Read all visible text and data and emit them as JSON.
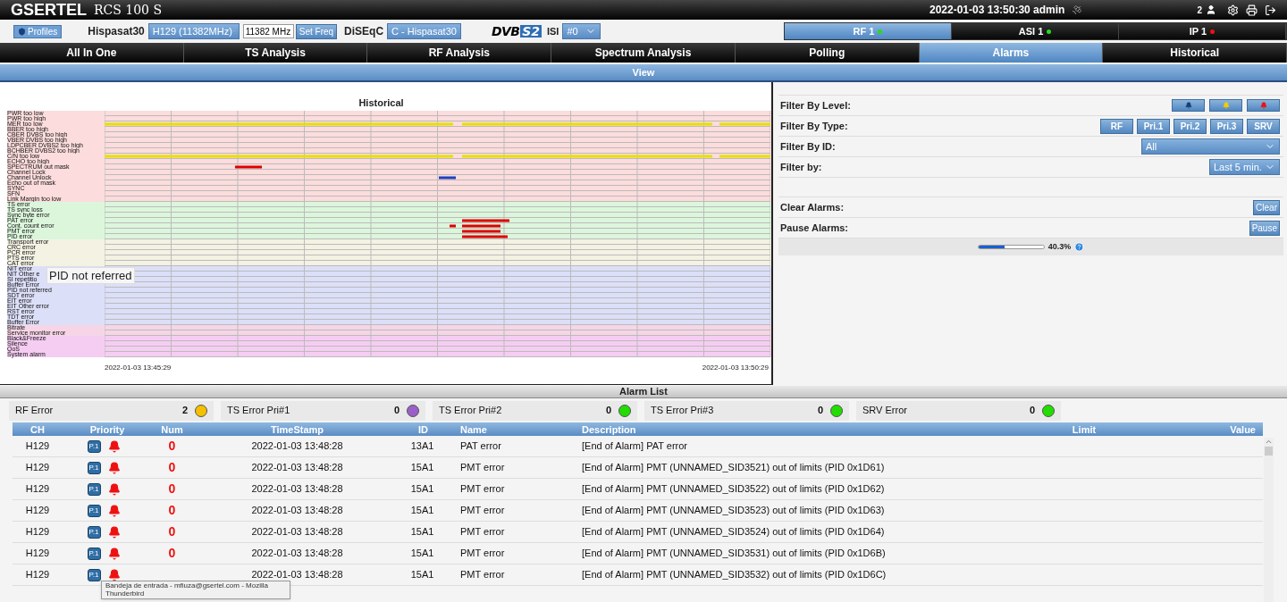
{
  "header": {
    "brand": "GSERTEL",
    "product": "RCS 100 S",
    "datetime_user": "2022-01-03 13:50:30 admin",
    "user_count": "2"
  },
  "toolbar": {
    "profiles_button": "Profiles",
    "satellite_label": "Hispasat30",
    "channel_select": "H129 (11382MHz)",
    "frequency": "11382 MHz",
    "set_freq_button": "Set Freq",
    "diseqc_label": "DiSEqC",
    "diseqc_select": "C - Hispasat30",
    "standard_logo": {
      "left": "DVB",
      "right": "S2"
    },
    "isi_label": "ISI",
    "isi_select": "#0"
  },
  "inputs": [
    {
      "label": "RF 1",
      "selected": true,
      "color": "#22dd22"
    },
    {
      "label": "ASI 1",
      "selected": false,
      "color": "#22dd22"
    },
    {
      "label": "IP 1",
      "selected": false,
      "color": "#ee1111"
    }
  ],
  "tabs": [
    {
      "label": "All In One",
      "selected": false
    },
    {
      "label": "TS Analysis",
      "selected": false
    },
    {
      "label": "RF Analysis",
      "selected": false
    },
    {
      "label": "Spectrum Analysis",
      "selected": false
    },
    {
      "label": "Polling",
      "selected": false
    },
    {
      "label": "Alarms",
      "selected": true
    },
    {
      "label": "Historical",
      "selected": false
    }
  ],
  "view_bar": "View",
  "historical": {
    "title": "Historical",
    "start_time": "2022-01-03 13:45:29",
    "end_time": "2022-01-03 13:50:29",
    "hover_tooltip": "PID not referred",
    "rows": [
      {
        "label": "PWR too low",
        "kind": "rf"
      },
      {
        "label": "PWR too high",
        "kind": "rf"
      },
      {
        "label": "MER too low",
        "kind": "rf"
      },
      {
        "label": "BBER too high",
        "kind": "rf"
      },
      {
        "label": "CBER DVBS too high",
        "kind": "rf"
      },
      {
        "label": "VBER DVBS too high",
        "kind": "rf"
      },
      {
        "label": "LDPCBER DVBS2 too high",
        "kind": "rf"
      },
      {
        "label": "BCHBER DVBS2 too high",
        "kind": "rf"
      },
      {
        "label": "C/N too low",
        "kind": "rf"
      },
      {
        "label": "ECHO too high",
        "kind": "rf"
      },
      {
        "label": "SPECTRUM out mask",
        "kind": "rf"
      },
      {
        "label": "Channel Lock",
        "kind": "rf"
      },
      {
        "label": "Channel Unlock",
        "kind": "rf"
      },
      {
        "label": "Echo out of mask",
        "kind": "rf"
      },
      {
        "label": "SYNC",
        "kind": "rf"
      },
      {
        "label": "SFN",
        "kind": "rf"
      },
      {
        "label": "Link Margin too low",
        "kind": "rf"
      },
      {
        "label": "TS error",
        "kind": "pri1"
      },
      {
        "label": "TS sync loss",
        "kind": "pri1"
      },
      {
        "label": "Sync byte error",
        "kind": "pri1"
      },
      {
        "label": "PAT error",
        "kind": "pri1"
      },
      {
        "label": "Cont. count error",
        "kind": "pri1"
      },
      {
        "label": "PMT error",
        "kind": "pri1"
      },
      {
        "label": "PID error",
        "kind": "pri1"
      },
      {
        "label": "Transport error",
        "kind": "pri2"
      },
      {
        "label": "CRC error",
        "kind": "pri2"
      },
      {
        "label": "PCR error",
        "kind": "pri2"
      },
      {
        "label": "PTS error",
        "kind": "pri2"
      },
      {
        "label": "CAT error",
        "kind": "pri2"
      },
      {
        "label": "NIT error",
        "kind": "pri3"
      },
      {
        "label": "NIT Other e",
        "kind": "pri3"
      },
      {
        "label": "SI repetitio",
        "kind": "pri3"
      },
      {
        "label": "Buffer Error",
        "kind": "pri3"
      },
      {
        "label": "PID not referred",
        "kind": "pri3"
      },
      {
        "label": "SDT error",
        "kind": "pri3"
      },
      {
        "label": "EIT error",
        "kind": "pri3"
      },
      {
        "label": "EIT Other error",
        "kind": "pri3"
      },
      {
        "label": "RST error",
        "kind": "pri3"
      },
      {
        "label": "TDT error",
        "kind": "pri3"
      },
      {
        "label": "Buffer Error",
        "kind": "pri3"
      },
      {
        "label": "Bitrate",
        "kind": "srv"
      },
      {
        "label": "Service monitor error",
        "kind": "srv"
      },
      {
        "label": "Black&Freeze",
        "kind": "qos"
      },
      {
        "label": "Silence",
        "kind": "qos"
      },
      {
        "label": "QoS",
        "kind": "qos"
      },
      {
        "label": "System alarm",
        "kind": "qos"
      }
    ]
  },
  "filters": {
    "level_label": "Filter By Level:",
    "levels": [
      {
        "color": "#1a3f7a"
      },
      {
        "color": "#f0d000"
      },
      {
        "color": "#ee1111"
      }
    ],
    "type_label": "Filter By Type:",
    "types": [
      "RF",
      "Pri.1",
      "Pri.2",
      "Pri.3",
      "SRV"
    ],
    "id_label": "Filter By ID:",
    "id_select": "All",
    "by_label": "Filter by:",
    "by_select": "Last 5 min.",
    "clear_label": "Clear Alarms:",
    "clear_button": "Clear",
    "pause_label": "Pause Alarms:",
    "pause_button": "Pause",
    "progress": {
      "level": 0.403,
      "reading": "40.3%"
    }
  },
  "alarm_list": {
    "title": "Alarm List",
    "summary": [
      {
        "label": "RF Error",
        "count": "2",
        "color": "#f5c000"
      },
      {
        "label": "TS Error Pri#1",
        "count": "0",
        "color": "#9a5fc8"
      },
      {
        "label": "TS Error Pri#2",
        "count": "0",
        "color": "#22dd00"
      },
      {
        "label": "TS Error Pri#3",
        "count": "0",
        "color": "#22dd00"
      },
      {
        "label": "SRV Error",
        "count": "0",
        "color": "#22dd00"
      }
    ],
    "columns": [
      "CH",
      "Priority",
      "Num",
      "TimeStamp",
      "ID",
      "Name",
      "Description",
      "Limit",
      "Value"
    ],
    "rows": [
      {
        "ch": "H129",
        "priority": "P.1",
        "num": "0",
        "timestamp": "2022-01-03 13:48:28",
        "id": "13A1",
        "name": "PAT error",
        "description": "[End of Alarm] PAT error"
      },
      {
        "ch": "H129",
        "priority": "P.1",
        "num": "0",
        "timestamp": "2022-01-03 13:48:28",
        "id": "15A1",
        "name": "PMT error",
        "description": "[End of Alarm] PMT (UNNAMED_SID3521) out of limits (PID 0x1D61)"
      },
      {
        "ch": "H129",
        "priority": "P.1",
        "num": "0",
        "timestamp": "2022-01-03 13:48:28",
        "id": "15A1",
        "name": "PMT error",
        "description": "[End of Alarm] PMT (UNNAMED_SID3522) out of limits (PID 0x1D62)"
      },
      {
        "ch": "H129",
        "priority": "P.1",
        "num": "0",
        "timestamp": "2022-01-03 13:48:28",
        "id": "15A1",
        "name": "PMT error",
        "description": "[End of Alarm] PMT (UNNAMED_SID3523) out of limits (PID 0x1D63)"
      },
      {
        "ch": "H129",
        "priority": "P.1",
        "num": "0",
        "timestamp": "2022-01-03 13:48:28",
        "id": "15A1",
        "name": "PMT error",
        "description": "[End of Alarm] PMT (UNNAMED_SID3524) out of limits (PID 0x1D64)"
      },
      {
        "ch": "H129",
        "priority": "P.1",
        "num": "0",
        "timestamp": "2022-01-03 13:48:28",
        "id": "15A1",
        "name": "PMT error",
        "description": "[End of Alarm] PMT (UNNAMED_SID3531) out of limits (PID 0x1D6B)"
      },
      {
        "ch": "H129",
        "priority": "P.1",
        "timestamp": "2022-01-03 13:48:28",
        "id": "15A1",
        "name": "PMT error",
        "description": "[End of Alarm] PMT (UNNAMED_SID3532) out of limits (PID 0x1D6C)"
      }
    ]
  },
  "taskbar_tooltip": "Bandeja de entrada - mfiuza@gsertel.com - Mozilla Thunderbird"
}
